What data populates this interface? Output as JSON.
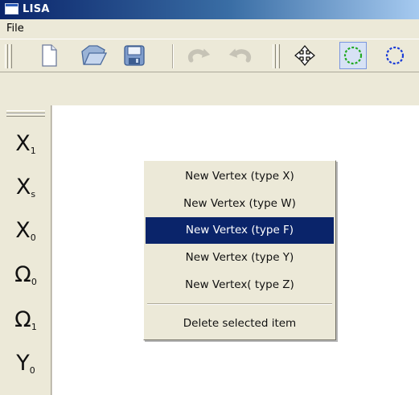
{
  "window": {
    "title": "LISA"
  },
  "menu": {
    "file_label": "File"
  },
  "toolbar": {
    "buttons": [
      {
        "name": "new-file-icon"
      },
      {
        "name": "open-folder-icon"
      },
      {
        "name": "save-icon"
      },
      {
        "name": "undo-icon",
        "enabled": false
      },
      {
        "name": "redo-icon",
        "enabled": false
      },
      {
        "name": "move-arrows-icon"
      },
      {
        "name": "green-dashed-circle-icon",
        "pressed": true,
        "color": "#22aa22"
      },
      {
        "name": "blue-dashed-circle-icon",
        "color": "#1a3cd8"
      }
    ]
  },
  "palette": {
    "items": [
      {
        "main": "X",
        "sub": "1"
      },
      {
        "main": "X",
        "sub": "s"
      },
      {
        "main": "X",
        "sub": "0"
      },
      {
        "main": "Ω",
        "sub": "0"
      },
      {
        "main": "Ω",
        "sub": "1"
      },
      {
        "main": "Y",
        "sub": "0"
      }
    ]
  },
  "context_menu": {
    "items": [
      {
        "label": "New Vertex (type X)"
      },
      {
        "label": "New Vertex (type W)"
      },
      {
        "label": "New Vertex (type F)",
        "selected": true
      },
      {
        "label": "New Vertex (type Y)"
      },
      {
        "label": "New Vertex( type Z)"
      }
    ],
    "delete_label": "Delete selected item"
  },
  "colors": {
    "selection": "#0a246a",
    "titlebar": "#0a246a",
    "face": "#ece9d8"
  }
}
